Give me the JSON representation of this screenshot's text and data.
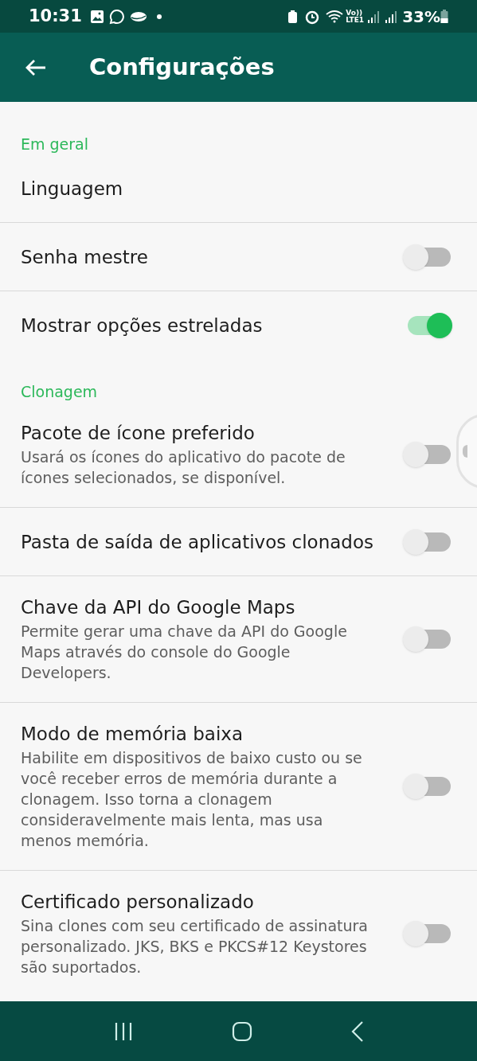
{
  "status_bar": {
    "time": "10:31",
    "volte": "Vo))",
    "lte": "LTE1",
    "battery": "33%"
  },
  "app_bar": {
    "title": "Configurações"
  },
  "sections": [
    {
      "header": "Em geral",
      "items": [
        {
          "title": "Linguagem"
        },
        {
          "title": "Senha mestre",
          "on": false
        },
        {
          "title": "Mostrar opções estreladas",
          "on": true
        }
      ]
    },
    {
      "header": "Clonagem",
      "items": [
        {
          "title": "Pacote de ícone preferido",
          "description": "Usará os ícones do aplicativo do pacote de ícones selecionados, se disponível.",
          "on": false
        },
        {
          "title": "Pasta de saída de aplicativos clonados",
          "on": false
        },
        {
          "title": "Chave da API do Google Maps",
          "description": "Permite gerar uma chave da API do Google Maps através do console do Google Developers.",
          "on": false
        },
        {
          "title": "Modo de memória baixa",
          "description": "Habilite em dispositivos de baixo custo ou se você receber erros de memória durante a clonagem. Isso torna a clonagem consideravelmente mais lenta, mas usa menos memória.",
          "on": false
        },
        {
          "title": "Certificado personalizado",
          "description": "Sina clones com seu certificado de assinatura personalizado. JKS, BKS e PKCS#12 Keystores são suportados.",
          "on": false
        }
      ]
    }
  ]
}
